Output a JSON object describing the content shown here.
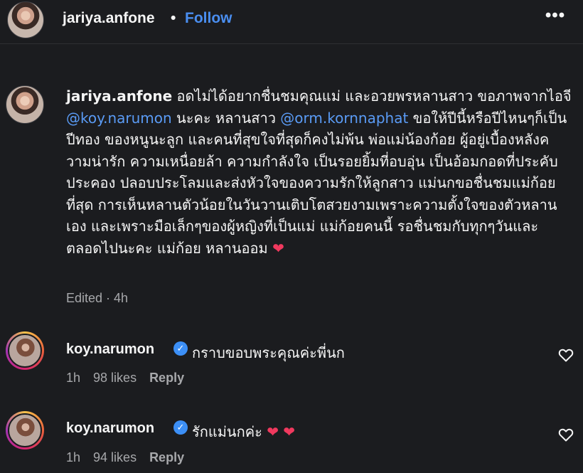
{
  "post": {
    "username": "jariya.anfone",
    "separator": "•",
    "follow_label": "Follow",
    "more_label": "•••"
  },
  "caption": {
    "author": "jariya.anfone",
    "text_1": " อดไม่ได้อยากชื่นชมคุณแม่ และอวยพรหลานสาว ขอภาพจากไอจี ",
    "mention_1": "@koy.narumon",
    "text_2": " นะคะ หลานสาว ",
    "mention_2": "@orm.kornnaphat",
    "text_3": " ขอให้ปีนี้หรือปีไหนๆก็เป็นปีทอง ของหนูนะลูก และคนที่สุขใจที่สุดก็คงไม่พ้น พ่อแม่น้องก้อย ผู้อยู่เบื้องหลังความน่ารัก ความเหนื่อยล้า ความกำลังใจ เป็นรอยยิ้มที่อบอุ่น เป็นอ้อมกอดที่ประคับประคอง ปลอบประโลมและส่งหัวใจของความรักให้ลูกสาว แม่นกขอชื่นชมแม่ก้อยที่สุด การเห็นหลานตัวน้อยในวันวานเติบโตสวยงามเพราะความตั้งใจของตัวหลานเอง และเพราะมือเล็กๆของผู้หญิงที่เป็นแม่ แม่ก้อยคนนี้ รอชื่นชมกับทุกๆวันและตลอดไปนะคะ แม่ก้อย หลานออม ",
    "heart": "❤",
    "edited": "Edited · 4h"
  },
  "comments": [
    {
      "user": "koy.narumon",
      "verified_glyph": "✓",
      "text": "กราบขอบพระคุณค่ะพี่นก",
      "hearts": "",
      "time": "1h",
      "likes": "98 likes",
      "reply": "Reply"
    },
    {
      "user": "koy.narumon",
      "verified_glyph": "✓",
      "text": "รักแม่นกค่ะ",
      "hearts": "❤ ❤",
      "time": "1h",
      "likes": "94 likes",
      "reply": "Reply"
    }
  ],
  "icons": {
    "heart_outline": "heart-outline-icon",
    "verified": "verified-badge-icon"
  },
  "colors": {
    "background": "#1b1c1f",
    "link": "#5a9bf5",
    "follow": "#4a8ef0",
    "heart": "#f0395e",
    "verified": "#3c8ff6",
    "muted": "#a7a8ab"
  }
}
